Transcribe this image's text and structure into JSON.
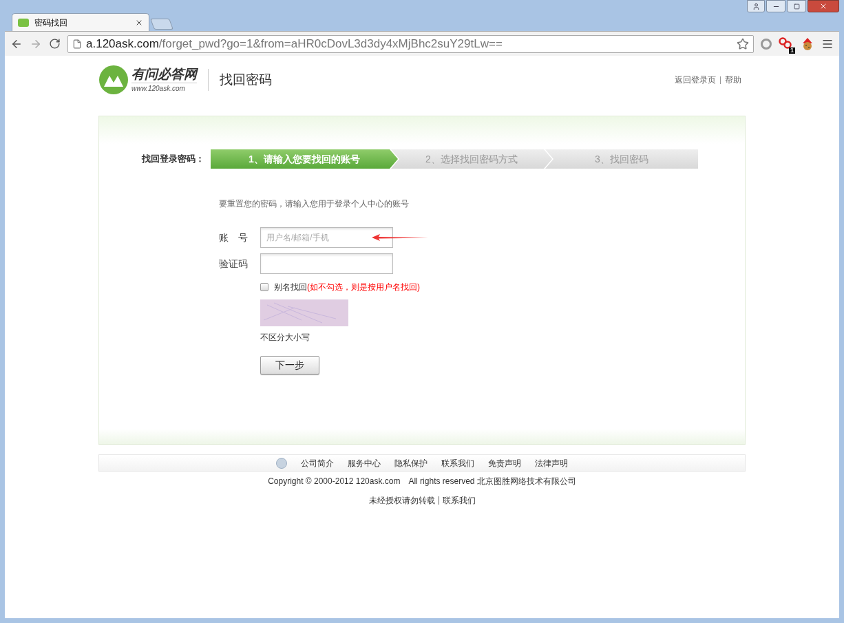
{
  "browser": {
    "tab": {
      "title": "密码找回"
    },
    "url": {
      "host": "a.120ask.com",
      "path": "/forget_pwd?go=1&from=aHR0cDovL3d3dy4xMjBhc2suY29tLw=="
    },
    "extension_badge": "1"
  },
  "header": {
    "logo": {
      "name": "有问必答网",
      "site": "www.120ask.com"
    },
    "title": "找回密码",
    "links": [
      "返回登录页",
      "帮助"
    ]
  },
  "steps": {
    "label": "找回登录密码：",
    "items": [
      {
        "label": "1、请输入您要找回的账号",
        "selected": true
      },
      {
        "label": "2、选择找回密码方式",
        "selected": false
      },
      {
        "label": "3、找回密码",
        "selected": false
      }
    ]
  },
  "form": {
    "intro": "要重置您的密码，请输入您用于登录个人中心的账号",
    "fields": [
      {
        "label": "账　号",
        "placeholder": "用户名/邮箱/手机"
      },
      {
        "label": "验证码"
      }
    ],
    "alias": {
      "label": "别名找回",
      "note": "(如不勾选，则是按用户名找回)",
      "checked": false
    },
    "captcha_hint": "不区分大小写",
    "submit": "下一步"
  },
  "footer": {
    "links": [
      "公司简介",
      "服务中心",
      "隐私保护",
      "联系我们",
      "免责声明",
      "法律声明"
    ],
    "copyright": "Copyright © 2000-2012 120ask.com",
    "rights": "All rights reserved 北京图胜网络技术有限公司",
    "bottom_links": [
      "未经授权请勿转载",
      "联系我们"
    ]
  }
}
